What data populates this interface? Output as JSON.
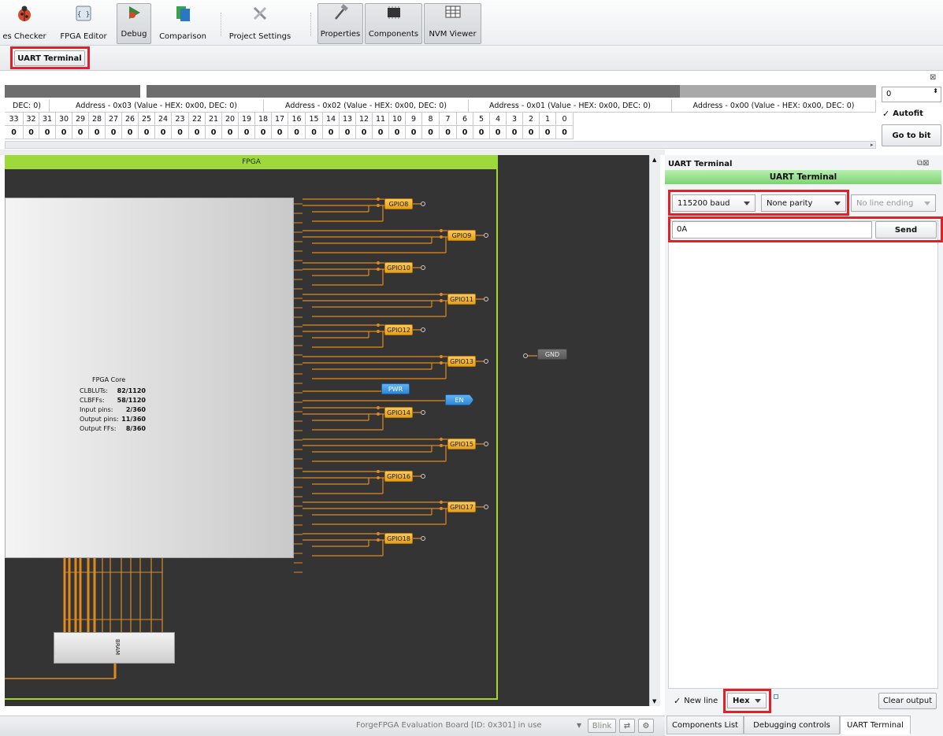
{
  "toolbar": {
    "buttons": [
      {
        "label": "es Checker",
        "icon": "ladybug-icon"
      },
      {
        "label": "FPGA Editor",
        "icon": "braces-icon"
      },
      {
        "label": "Debug",
        "icon": "debug-icon"
      },
      {
        "label": "Comparison",
        "icon": "comparison-icon"
      },
      {
        "label": "Project Settings",
        "icon": "tools-icon"
      },
      {
        "label": "Properties",
        "icon": "hammer-icon"
      },
      {
        "label": "Components",
        "icon": "chip-icon"
      },
      {
        "label": "NVM Viewer",
        "icon": "grid-icon"
      }
    ]
  },
  "subbar": {
    "uart_button": "UART Terminal"
  },
  "registers": {
    "addresses": [
      "DEC: 0)",
      "Address - 0x03 (Value - HEX: 0x00, DEC: 0)",
      "Address - 0x02 (Value - HEX: 0x00, DEC: 0)",
      "Address - 0x01 (Value - HEX: 0x00, DEC: 0)",
      "Address - 0x00 (Value - HEX: 0x00, DEC: 0)"
    ],
    "bits": [
      "33",
      "32",
      "31",
      "30",
      "29",
      "28",
      "27",
      "26",
      "25",
      "24",
      "23",
      "22",
      "21",
      "20",
      "19",
      "18",
      "17",
      "16",
      "15",
      "14",
      "13",
      "12",
      "11",
      "10",
      "9",
      "8",
      "7",
      "6",
      "5",
      "4",
      "3",
      "2",
      "1",
      "0"
    ],
    "values": [
      "0",
      "0",
      "0",
      "0",
      "0",
      "0",
      "0",
      "0",
      "0",
      "0",
      "0",
      "0",
      "0",
      "0",
      "0",
      "0",
      "0",
      "0",
      "0",
      "0",
      "0",
      "0",
      "0",
      "0",
      "0",
      "0",
      "0",
      "0",
      "0",
      "0",
      "0",
      "0",
      "0",
      "0"
    ],
    "spin_value": "0",
    "autofit_label": "Autofit",
    "autofit_check": "✓",
    "goto_label": "Go to bit"
  },
  "canvas": {
    "fpga_title": "FPGA",
    "core": {
      "title": "FPGA Core",
      "rows": [
        {
          "k": "CLBLUTs:",
          "v": "82/1120"
        },
        {
          "k": "CLBFFs:",
          "v": "58/1120"
        },
        {
          "k": "Input pins:",
          "v": "2/360"
        },
        {
          "k": "Output pins:",
          "v": "11/360"
        },
        {
          "k": "Output FFs:",
          "v": "8/360"
        }
      ]
    },
    "gpios": [
      "GPIO8",
      "GPIO9",
      "GPIO10",
      "GPIO11",
      "GPIO12",
      "GPIO13",
      "GPIO14",
      "GPIO15",
      "GPIO16",
      "GPIO17",
      "GPIO18"
    ],
    "pwr": "PWR",
    "en": "EN",
    "gnd": "GND",
    "bram": "BRAM"
  },
  "status": {
    "board": "ForgeFPGA Evaluation Board [ID: 0x301] in use",
    "blink": "Blink"
  },
  "uart": {
    "panel_title": "UART Terminal",
    "header": "UART Terminal",
    "baud": "115200 baud",
    "parity": "None parity",
    "line_ending": "No line ending",
    "input_value": "0A",
    "send": "Send",
    "newline_label": "New line",
    "newline_check": "✓",
    "format": "Hex",
    "clear": "Clear output"
  },
  "tabs": [
    "Components List",
    "Debugging controls",
    "UART Terminal"
  ],
  "colors": {
    "highlight": "#e0202b",
    "header_green": "#8fe08a",
    "gpio": "#f0b43a"
  }
}
